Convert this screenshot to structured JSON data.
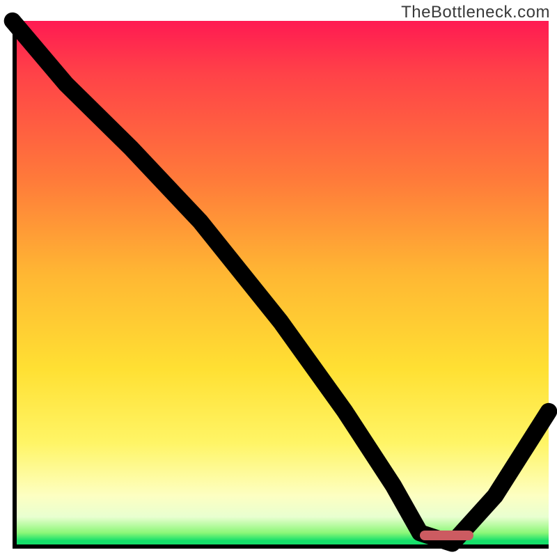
{
  "watermark": "TheBottleneck.com",
  "chart_data": {
    "type": "line",
    "title": "",
    "xlabel": "",
    "ylabel": "",
    "xlim": [
      0,
      100
    ],
    "ylim": [
      0,
      100
    ],
    "grid": false,
    "series": [
      {
        "name": "bottleneck-curve",
        "x": [
          0,
          10,
          22,
          35,
          50,
          62,
          71,
          76,
          82,
          90,
          100
        ],
        "y": [
          100,
          88,
          76,
          62,
          43,
          26,
          12,
          3,
          1,
          10,
          26
        ]
      }
    ],
    "marker": {
      "x_start": 76,
      "x_end": 86,
      "y": 1,
      "color": "#cc5b61"
    },
    "gradient_stops": [
      {
        "pos": 0,
        "color": "#ff1a52"
      },
      {
        "pos": 0.3,
        "color": "#ff7a3a"
      },
      {
        "pos": 0.66,
        "color": "#ffe033"
      },
      {
        "pos": 0.9,
        "color": "#fdffc2"
      },
      {
        "pos": 0.985,
        "color": "#16e06b"
      },
      {
        "pos": 1.0,
        "color": "#16e06b"
      }
    ]
  }
}
